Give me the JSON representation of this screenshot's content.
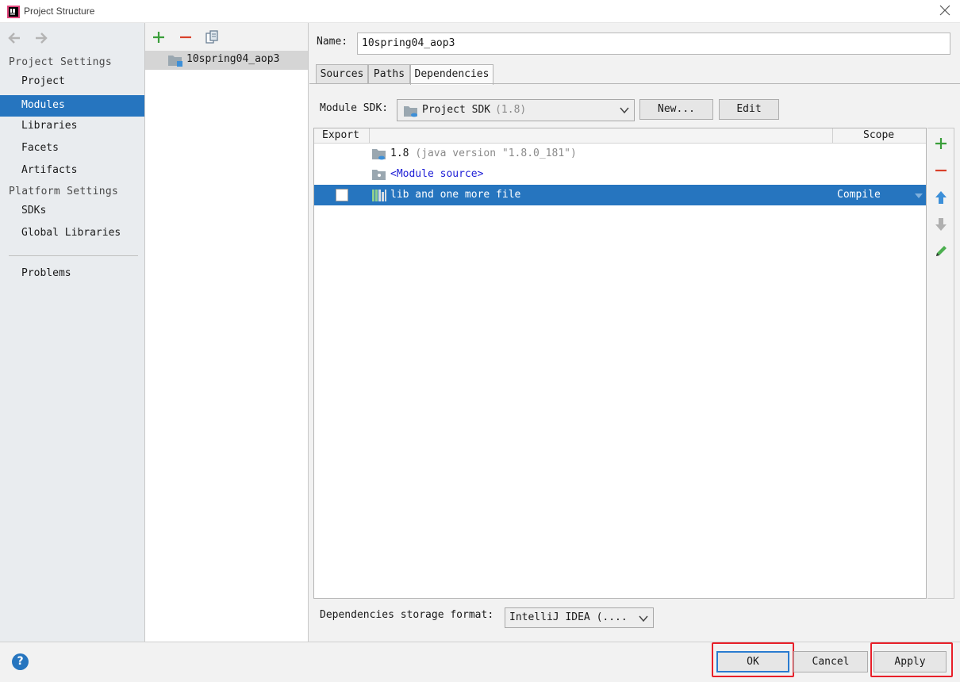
{
  "window": {
    "title": "Project Structure",
    "app_icon": "intellij-icon",
    "close_icon": "close-icon"
  },
  "sidebar": {
    "nav": [
      "back-arrow-icon",
      "forward-arrow-icon"
    ],
    "sections": [
      {
        "label": "Project Settings",
        "items": [
          "Project",
          "Modules",
          "Libraries",
          "Facets",
          "Artifacts"
        ]
      },
      {
        "label": "Platform Settings",
        "items": [
          "SDKs",
          "Global Libraries"
        ]
      }
    ],
    "problems": "Problems",
    "selected": "Modules"
  },
  "module_panel": {
    "toolbar": [
      "add-icon",
      "remove-icon",
      "copy-icon"
    ],
    "modules": [
      {
        "name": "10spring04_aop3",
        "selected": true
      }
    ]
  },
  "details": {
    "name_label": "Name:",
    "name_value": "10spring04_aop3",
    "tabs": [
      "Sources",
      "Paths",
      "Dependencies"
    ],
    "active_tab": "Dependencies",
    "sdk": {
      "label": "Module SDK:",
      "selected": "Project SDK",
      "version": "(1.8)",
      "new_button": "New...",
      "edit_button": "Edit"
    },
    "table": {
      "columns": [
        "Export",
        "Scope"
      ],
      "rows": [
        {
          "name": "1.8",
          "detail": "(java version \"1.8.0_181\")",
          "icon": "jdk-folder-icon",
          "type": "sdk"
        },
        {
          "name": "<Module source>",
          "icon": "module-source-folder-icon",
          "type": "source"
        },
        {
          "name": "lib and one more file",
          "icon": "library-icon",
          "type": "library",
          "export": false,
          "scope": "Compile",
          "selected": true
        }
      ]
    },
    "side_tools": [
      "add-icon",
      "remove-icon",
      "move-up-icon",
      "move-down-icon",
      "edit-pencil-icon"
    ],
    "storage": {
      "label": "Dependencies storage format:",
      "value": "IntelliJ IDEA (...."
    }
  },
  "footer": {
    "help": "?",
    "ok": "OK",
    "cancel": "Cancel",
    "apply": "Apply"
  },
  "colors": {
    "selection": "#2675bf",
    "highlight_box": "#e8202a",
    "sidebar_bg": "#e9ecef"
  }
}
